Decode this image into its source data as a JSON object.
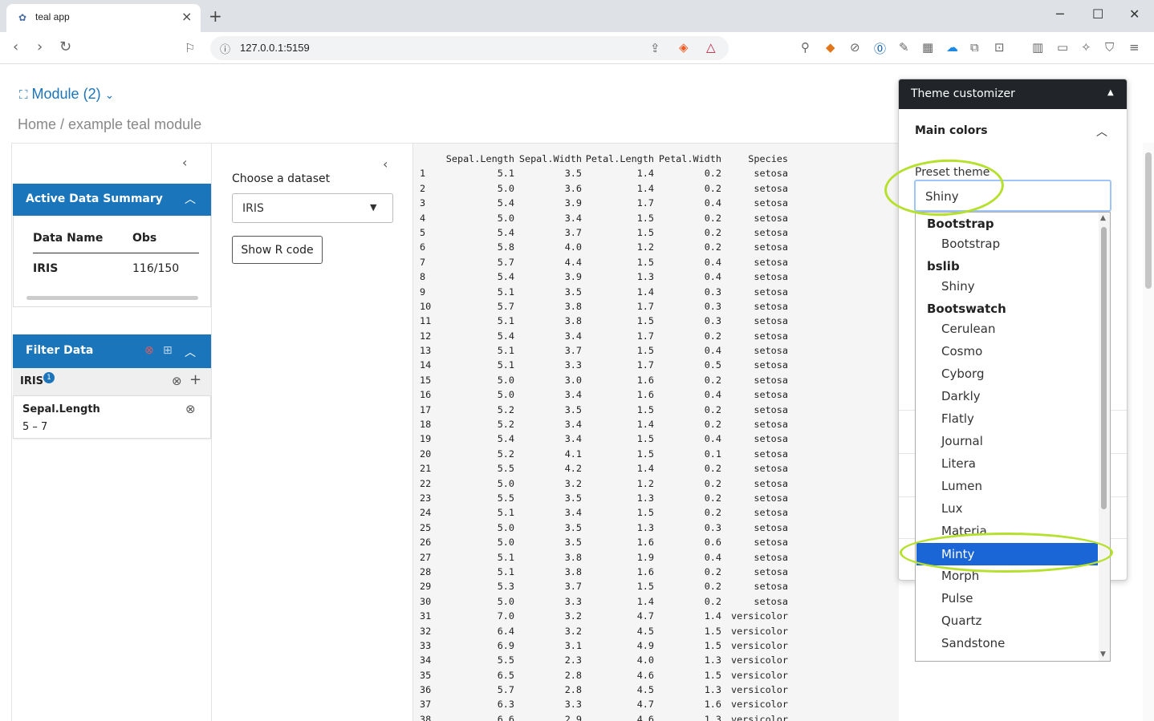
{
  "browser": {
    "tab_title": "teal app",
    "url": "127.0.0.1:5159"
  },
  "app": {
    "module_nav": "Module (2)",
    "breadcrumb": "Home / example teal module"
  },
  "active_data_summary": {
    "title": "Active Data Summary",
    "columns": [
      "Data Name",
      "Obs"
    ],
    "rows": [
      [
        "IRIS",
        "116/150"
      ]
    ]
  },
  "filter_data": {
    "title": "Filter Data",
    "dataset": "IRIS",
    "badge": "1",
    "filters": [
      {
        "variable": "Sepal.Length",
        "range": "5 – 7"
      }
    ]
  },
  "encoding": {
    "choose_label": "Choose a dataset",
    "selected_dataset": "IRIS",
    "show_code_label": "Show R code"
  },
  "table": {
    "headers": [
      "",
      "Sepal.Length",
      "Sepal.Width",
      "Petal.Length",
      "Petal.Width",
      "Species"
    ],
    "rows": [
      [
        "1",
        "5.1",
        "3.5",
        "1.4",
        "0.2",
        "setosa"
      ],
      [
        "2",
        "5.0",
        "3.6",
        "1.4",
        "0.2",
        "setosa"
      ],
      [
        "3",
        "5.4",
        "3.9",
        "1.7",
        "0.4",
        "setosa"
      ],
      [
        "4",
        "5.0",
        "3.4",
        "1.5",
        "0.2",
        "setosa"
      ],
      [
        "5",
        "5.4",
        "3.7",
        "1.5",
        "0.2",
        "setosa"
      ],
      [
        "6",
        "5.8",
        "4.0",
        "1.2",
        "0.2",
        "setosa"
      ],
      [
        "7",
        "5.7",
        "4.4",
        "1.5",
        "0.4",
        "setosa"
      ],
      [
        "8",
        "5.4",
        "3.9",
        "1.3",
        "0.4",
        "setosa"
      ],
      [
        "9",
        "5.1",
        "3.5",
        "1.4",
        "0.3",
        "setosa"
      ],
      [
        "10",
        "5.7",
        "3.8",
        "1.7",
        "0.3",
        "setosa"
      ],
      [
        "11",
        "5.1",
        "3.8",
        "1.5",
        "0.3",
        "setosa"
      ],
      [
        "12",
        "5.4",
        "3.4",
        "1.7",
        "0.2",
        "setosa"
      ],
      [
        "13",
        "5.1",
        "3.7",
        "1.5",
        "0.4",
        "setosa"
      ],
      [
        "14",
        "5.1",
        "3.3",
        "1.7",
        "0.5",
        "setosa"
      ],
      [
        "15",
        "5.0",
        "3.0",
        "1.6",
        "0.2",
        "setosa"
      ],
      [
        "16",
        "5.0",
        "3.4",
        "1.6",
        "0.4",
        "setosa"
      ],
      [
        "17",
        "5.2",
        "3.5",
        "1.5",
        "0.2",
        "setosa"
      ],
      [
        "18",
        "5.2",
        "3.4",
        "1.4",
        "0.2",
        "setosa"
      ],
      [
        "19",
        "5.4",
        "3.4",
        "1.5",
        "0.4",
        "setosa"
      ],
      [
        "20",
        "5.2",
        "4.1",
        "1.5",
        "0.1",
        "setosa"
      ],
      [
        "21",
        "5.5",
        "4.2",
        "1.4",
        "0.2",
        "setosa"
      ],
      [
        "22",
        "5.0",
        "3.2",
        "1.2",
        "0.2",
        "setosa"
      ],
      [
        "23",
        "5.5",
        "3.5",
        "1.3",
        "0.2",
        "setosa"
      ],
      [
        "24",
        "5.1",
        "3.4",
        "1.5",
        "0.2",
        "setosa"
      ],
      [
        "25",
        "5.0",
        "3.5",
        "1.3",
        "0.3",
        "setosa"
      ],
      [
        "26",
        "5.0",
        "3.5",
        "1.6",
        "0.6",
        "setosa"
      ],
      [
        "27",
        "5.1",
        "3.8",
        "1.9",
        "0.4",
        "setosa"
      ],
      [
        "28",
        "5.1",
        "3.8",
        "1.6",
        "0.2",
        "setosa"
      ],
      [
        "29",
        "5.3",
        "3.7",
        "1.5",
        "0.2",
        "setosa"
      ],
      [
        "30",
        "5.0",
        "3.3",
        "1.4",
        "0.2",
        "setosa"
      ],
      [
        "31",
        "7.0",
        "3.2",
        "4.7",
        "1.4",
        "versicolor"
      ],
      [
        "32",
        "6.4",
        "3.2",
        "4.5",
        "1.5",
        "versicolor"
      ],
      [
        "33",
        "6.9",
        "3.1",
        "4.9",
        "1.5",
        "versicolor"
      ],
      [
        "34",
        "5.5",
        "2.3",
        "4.0",
        "1.3",
        "versicolor"
      ],
      [
        "35",
        "6.5",
        "2.8",
        "4.6",
        "1.5",
        "versicolor"
      ],
      [
        "36",
        "5.7",
        "2.8",
        "4.5",
        "1.3",
        "versicolor"
      ],
      [
        "37",
        "6.3",
        "3.3",
        "4.7",
        "1.6",
        "versicolor"
      ],
      [
        "38",
        "6.6",
        "2.9",
        "4.6",
        "1.3",
        "versicolor"
      ]
    ]
  },
  "theme_customizer": {
    "title": "Theme customizer",
    "section": "Main colors",
    "preset_label": "Preset theme",
    "preset_value": "Shiny",
    "groups": [
      {
        "label": "Bootstrap",
        "options": [
          "Bootstrap"
        ]
      },
      {
        "label": "bslib",
        "options": [
          "Shiny"
        ]
      },
      {
        "label": "Bootswatch",
        "options": [
          "Cerulean",
          "Cosmo",
          "Cyborg",
          "Darkly",
          "Flatly",
          "Journal",
          "Litera",
          "Lumen",
          "Lux",
          "Materia",
          "Minty",
          "Morph",
          "Pulse",
          "Quartz",
          "Sandstone"
        ]
      }
    ],
    "highlighted_option": "Minty"
  },
  "colors": {
    "accent": "#1b75bb",
    "selected": "#1b66d6",
    "highlight_ring": "#b5e02b"
  }
}
